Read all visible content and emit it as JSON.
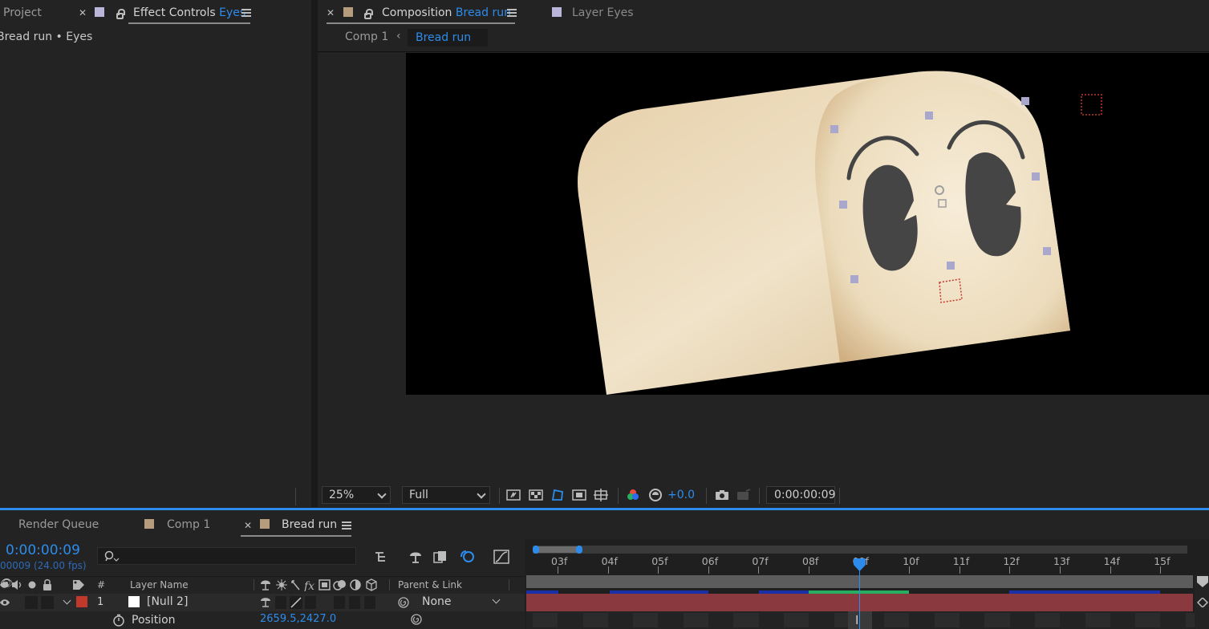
{
  "left_panel": {
    "tab_project": "Project",
    "tab_effect_controls_prefix": "Effect Controls",
    "tab_effect_controls_layer": "Eyes",
    "breadcrumb": "Bread run • Eyes"
  },
  "viewer": {
    "tab_composition_prefix": "Composition",
    "tab_composition_name": "Bread run",
    "tab_layer_prefix": "Layer",
    "tab_layer_name": "Eyes",
    "crumb_comp1": "Comp 1",
    "crumb_active": "Bread run",
    "zoom": "25%",
    "resolution": "Full",
    "exposure": "+0.0",
    "timecode": "0:00:00:09"
  },
  "timeline": {
    "tab_render_queue": "Render Queue",
    "tab_comp1": "Comp 1",
    "tab_bread_run": "Bread run",
    "current_time": "0:00:00:09",
    "frame_info": "00009 (24.00 fps)",
    "search_placeholder": "",
    "col_hash": "#",
    "col_layer_name": "Layer Name",
    "col_parent": "Parent & Link",
    "ruler_ticks": [
      "03f",
      "04f",
      "05f",
      "06f",
      "07f",
      "08f",
      "09f",
      "10f",
      "11f",
      "12f",
      "13f",
      "14f",
      "15f"
    ],
    "playhead_frame": 9,
    "layer": {
      "index": "1",
      "name": "[Null 2]",
      "parent": "None",
      "label_color": "#c0392b"
    },
    "property": {
      "name": "Position",
      "value": "2659.5,2427.0"
    }
  },
  "colors": {
    "accent": "#2d8ceb",
    "panel_bg": "#232323",
    "layer_bar": "#8a3a3f"
  }
}
